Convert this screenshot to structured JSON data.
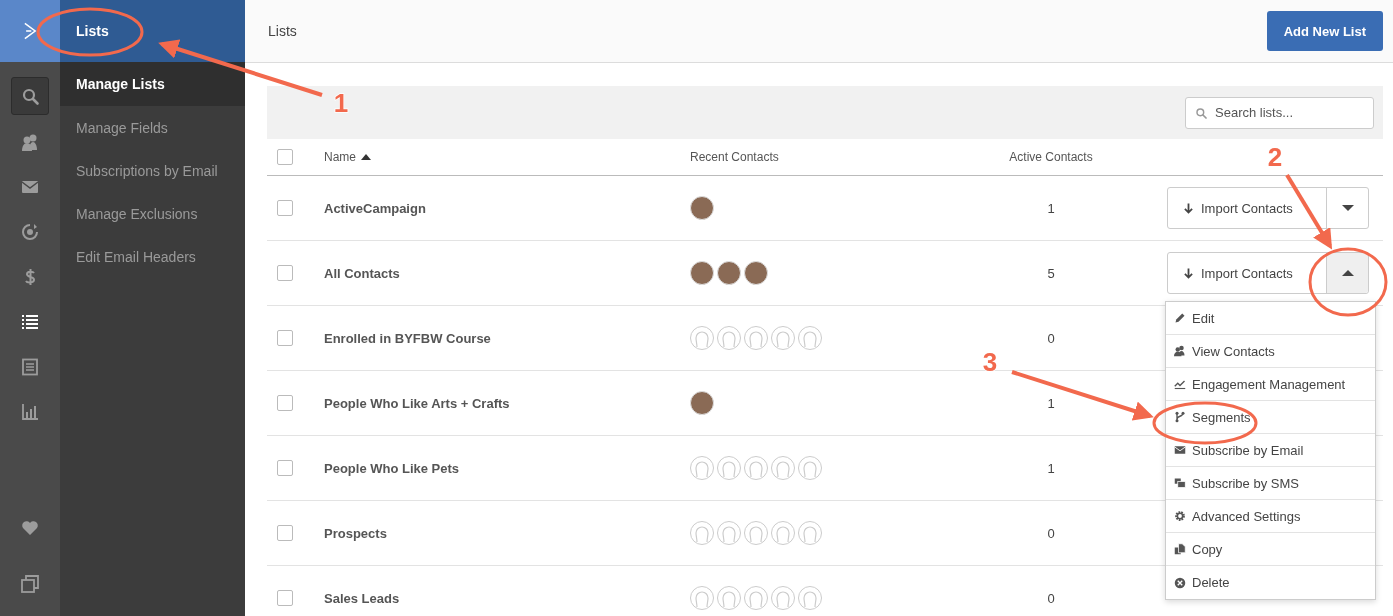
{
  "rail": {
    "items": [
      {
        "kind": "search",
        "selected": false
      },
      {
        "kind": "contacts",
        "selected": false
      },
      {
        "kind": "mail",
        "selected": false
      },
      {
        "kind": "automation",
        "selected": false
      },
      {
        "kind": "deals",
        "selected": false
      },
      {
        "kind": "lists",
        "selected": true
      },
      {
        "kind": "forms",
        "selected": false
      },
      {
        "kind": "reports",
        "selected": false
      }
    ],
    "bottom_items": [
      {
        "kind": "heart",
        "selected": false
      },
      {
        "kind": "windows",
        "selected": false
      }
    ]
  },
  "subnav": {
    "title": "Lists",
    "items": [
      {
        "label": "Manage Lists",
        "selected": true
      },
      {
        "label": "Manage Fields",
        "selected": false
      },
      {
        "label": "Subscriptions by Email",
        "selected": false
      },
      {
        "label": "Manage Exclusions",
        "selected": false
      },
      {
        "label": "Edit Email Headers",
        "selected": false
      }
    ]
  },
  "header": {
    "title": "Lists",
    "add_button": "Add New List"
  },
  "search": {
    "placeholder": "Search lists..."
  },
  "table": {
    "select_all_checked": false,
    "columns": [
      {
        "label": "Name",
        "sorted": true
      },
      {
        "label": "Recent Contacts",
        "sorted": false
      },
      {
        "label": "Active Contacts",
        "sorted": false
      }
    ],
    "rows": [
      {
        "name": "ActiveCampaign",
        "checked": false,
        "recent_contacts": [
          {
            "kind": "photo"
          }
        ],
        "active_contacts": "1",
        "action": "Import Contacts",
        "expanded": false
      },
      {
        "name": "All Contacts",
        "checked": false,
        "recent_contacts": [
          {
            "kind": "photo"
          },
          {
            "kind": "photo"
          },
          {
            "kind": "photo"
          }
        ],
        "active_contacts": "5",
        "action": "Import Contacts",
        "expanded": true
      },
      {
        "name": "Enrolled in BYFBW Course",
        "checked": false,
        "recent_contacts": [
          {
            "kind": "empty"
          },
          {
            "kind": "empty"
          },
          {
            "kind": "empty"
          },
          {
            "kind": "empty"
          },
          {
            "kind": "empty"
          }
        ],
        "active_contacts": "0"
      },
      {
        "name": "People Who Like Arts + Crafts",
        "checked": false,
        "recent_contacts": [
          {
            "kind": "photo"
          }
        ],
        "active_contacts": "1"
      },
      {
        "name": "People Who Like Pets",
        "checked": false,
        "recent_contacts": [
          {
            "kind": "empty"
          },
          {
            "kind": "empty"
          },
          {
            "kind": "empty"
          },
          {
            "kind": "empty"
          },
          {
            "kind": "empty"
          }
        ],
        "active_contacts": "1"
      },
      {
        "name": "Prospects",
        "checked": false,
        "recent_contacts": [
          {
            "kind": "empty"
          },
          {
            "kind": "empty"
          },
          {
            "kind": "empty"
          },
          {
            "kind": "empty"
          },
          {
            "kind": "empty"
          }
        ],
        "active_contacts": "0"
      },
      {
        "name": "Sales Leads",
        "checked": false,
        "recent_contacts": [
          {
            "kind": "empty"
          },
          {
            "kind": "empty"
          },
          {
            "kind": "empty"
          },
          {
            "kind": "empty"
          },
          {
            "kind": "empty"
          }
        ],
        "active_contacts": "0"
      }
    ]
  },
  "row_menu": {
    "items": [
      {
        "label": "Edit",
        "kind": "edit"
      },
      {
        "label": "View Contacts",
        "kind": "contacts"
      },
      {
        "label": "Engagement Management",
        "kind": "trend"
      },
      {
        "label": "Segments",
        "kind": "branch"
      },
      {
        "label": "Subscribe by Email",
        "kind": "mail"
      },
      {
        "label": "Subscribe by SMS",
        "kind": "sms"
      },
      {
        "label": "Advanced Settings",
        "kind": "gear"
      },
      {
        "label": "Copy",
        "kind": "copy"
      },
      {
        "label": "Delete",
        "kind": "delete"
      }
    ]
  },
  "callouts": [
    {
      "label": "1"
    },
    {
      "label": "2"
    },
    {
      "label": "3"
    }
  ]
}
